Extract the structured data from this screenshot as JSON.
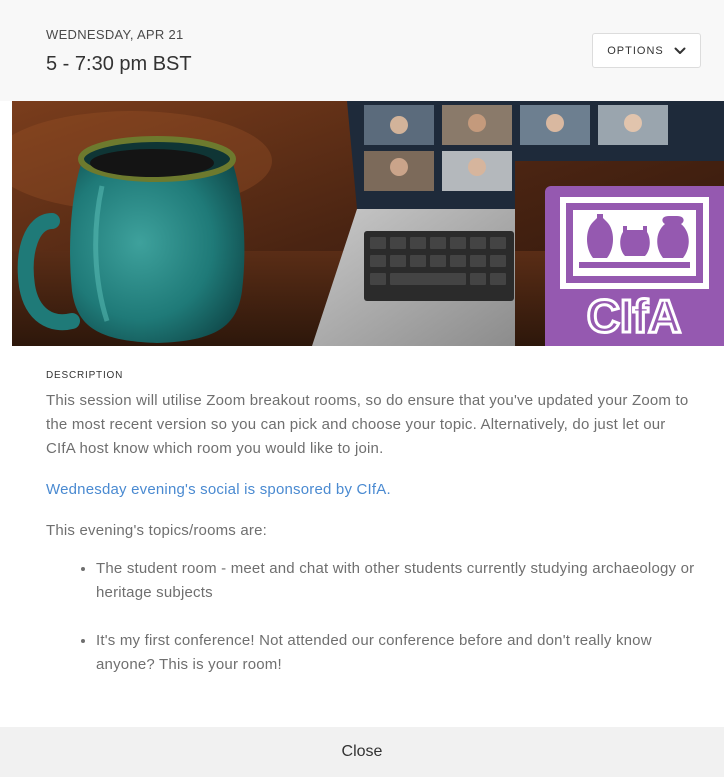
{
  "header": {
    "date": "WEDNESDAY, APR 21",
    "time": "5 - 7:30 pm BST",
    "options_label": "OPTIONS"
  },
  "banner": {
    "logo_text": "CIfA"
  },
  "description": {
    "label": "DESCRIPTION",
    "body": "This session will utilise Zoom breakout rooms, so do ensure that you've updated your Zoom to the most recent version so you can pick and choose your topic. Alternatively, do just let our CIfA host know which room you would like to join.",
    "sponsor": "Wednesday evening's social is sponsored by CIfA.",
    "topics_intro": "This evening's topics/rooms are:",
    "topics": [
      "The student room - meet and chat with other students currently studying archaeology or heritage subjects",
      "It's my first conference! Not attended our conference before and don't really know anyone? This is your room!"
    ]
  },
  "footer": {
    "close_label": "Close"
  },
  "colors": {
    "accent_link": "#4a8ad1",
    "logo_bg": "#9559b0"
  }
}
